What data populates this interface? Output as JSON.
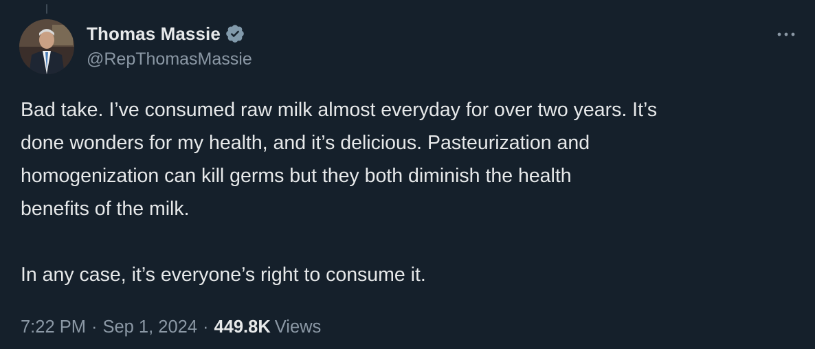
{
  "author": {
    "display_name": "Thomas Massie",
    "handle": "@RepThomasMassie",
    "verified_color": "#829aab"
  },
  "tweet": {
    "paragraphs": [
      "Bad take. I’ve consumed raw milk almost everyday for over two years. It’s\ndone wonders for my health, and it’s delicious. Pasteurization and\nhomogenization can kill germs but they both diminish the health\nbenefits of the milk.",
      "In any case, it’s everyone’s right to consume it."
    ]
  },
  "meta": {
    "time": "7:22 PM",
    "separator": "·",
    "date": "Sep 1, 2024",
    "views_count": "449.8K",
    "views_label": "Views"
  },
  "icons": {
    "verified": "verified-badge-icon",
    "more": "more-horizontal-icon"
  },
  "colors": {
    "background": "#15202b",
    "text": "#e7e9ea",
    "secondary": "#8b98a5"
  }
}
